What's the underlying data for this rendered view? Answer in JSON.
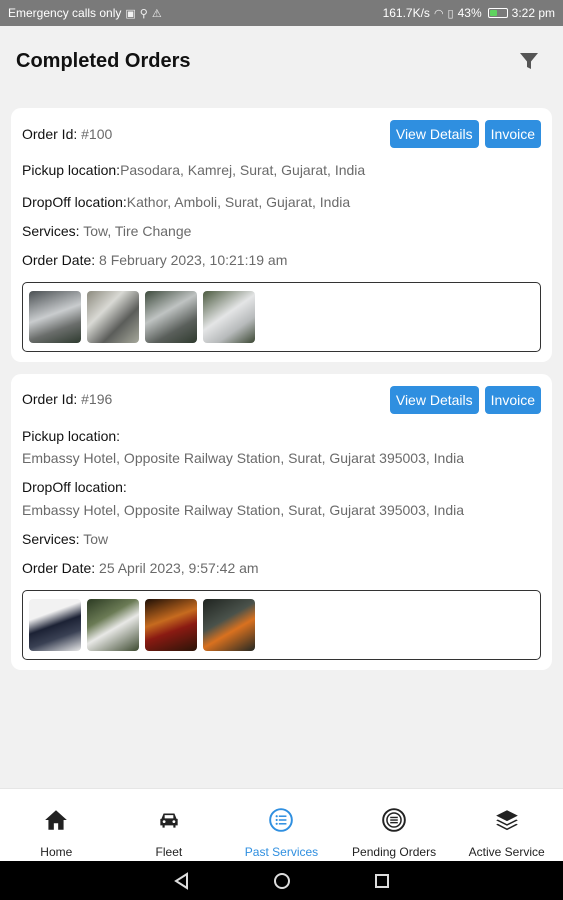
{
  "status_bar": {
    "left_text": "Emergency calls only",
    "speed": "161.7K/s",
    "battery": "43%",
    "battery_level": 0.43,
    "time": "3:22 pm"
  },
  "header": {
    "title": "Completed Orders",
    "filter_icon": "filter-icon"
  },
  "orders": [
    {
      "order_id_label": "Order Id:",
      "order_id": "#100",
      "view_details_label": "View Details",
      "invoice_label": "Invoice",
      "pickup_label": "Pickup location:",
      "pickup_value": "Pasodara, Kamrej, Surat, Gujarat, India",
      "dropoff_label": "DropOff location:",
      "dropoff_value": "Kathor, Amboli, Surat, Gujarat, India",
      "services_label": "Services:",
      "services_value": "Tow, Tire Change",
      "date_label": "Order Date:",
      "date_value": "8 February 2023, 10:21:19 am"
    },
    {
      "order_id_label": "Order Id:",
      "order_id": "#196",
      "view_details_label": "View Details",
      "invoice_label": "Invoice",
      "pickup_label": "Pickup location:",
      "pickup_value": "Embassy Hotel, Opposite Railway Station, Surat, Gujarat 395003, India",
      "dropoff_label": "DropOff location:",
      "dropoff_value": "Embassy Hotel, Opposite Railway Station, Surat, Gujarat 395003, India",
      "services_label": "Services:",
      "services_value": "Tow",
      "date_label": "Order Date:",
      "date_value": "25 April 2023, 9:57:42 am"
    }
  ],
  "bottom_nav": [
    {
      "label": "Home",
      "icon": "home-icon",
      "active": false
    },
    {
      "label": "Fleet",
      "icon": "car-icon",
      "active": false
    },
    {
      "label": "Past Services",
      "icon": "list-icon",
      "active": true
    },
    {
      "label": "Pending Orders",
      "icon": "list-circle-icon",
      "active": false
    },
    {
      "label": "Active Service",
      "icon": "layers-icon",
      "active": false
    }
  ],
  "colors": {
    "accent": "#2f8fe0",
    "background": "#f1f1f1",
    "status_bar": "#7a7a7a"
  }
}
